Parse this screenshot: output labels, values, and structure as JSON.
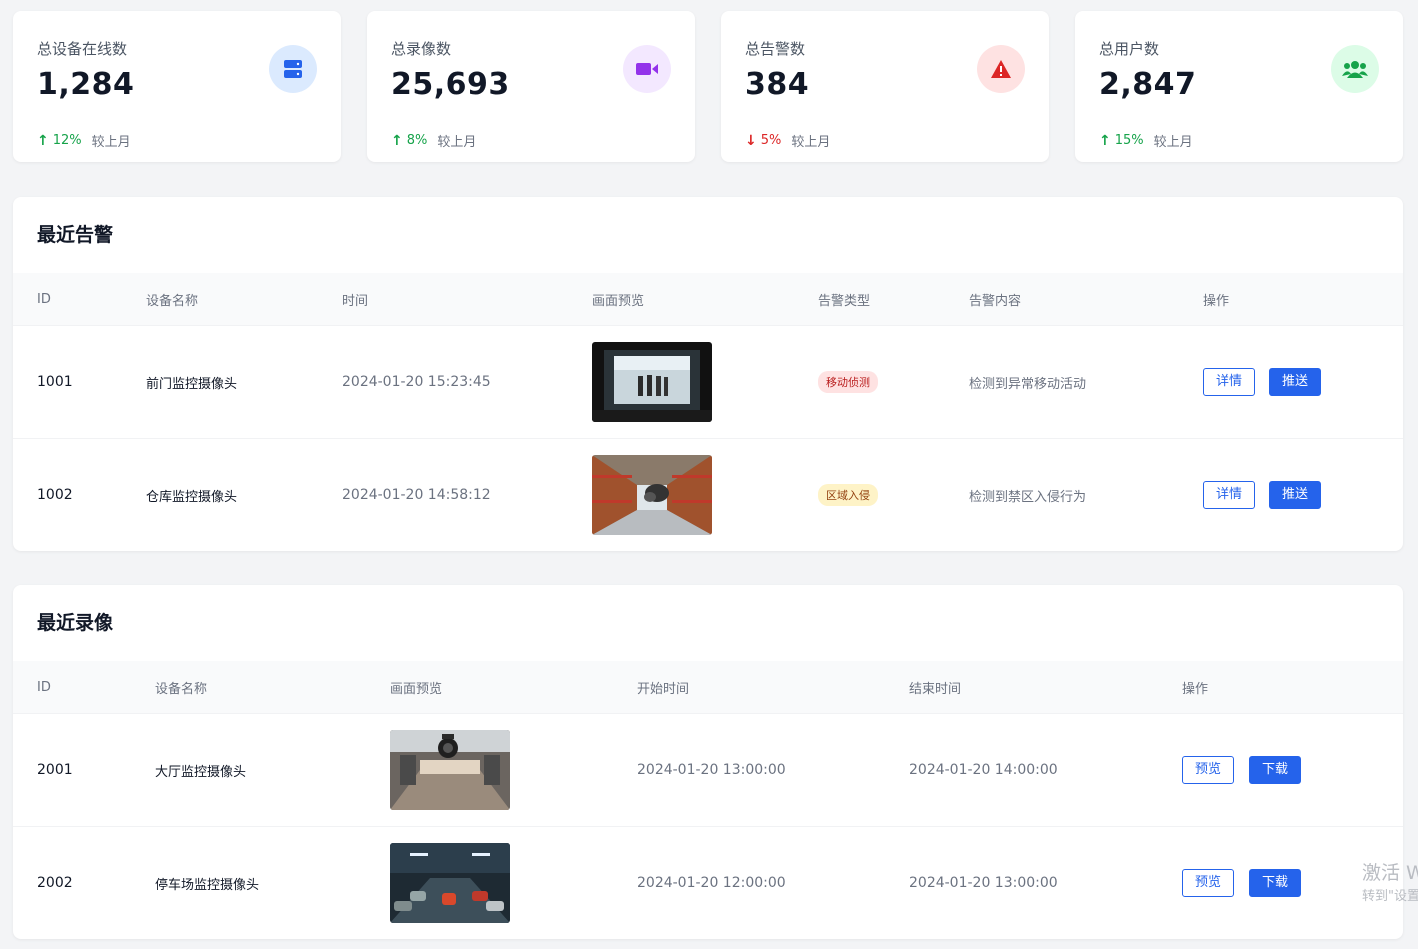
{
  "stats": [
    {
      "label": "总设备在线数",
      "value": "1,284",
      "trend": "12%",
      "direction": "up",
      "note": "较上月",
      "icon": "server-icon",
      "icon_color": "#2563eb",
      "icon_bg": "#dbeafe"
    },
    {
      "label": "总录像数",
      "value": "25,693",
      "trend": "8%",
      "direction": "up",
      "note": "较上月",
      "icon": "video-camera-icon",
      "icon_color": "#9333ea",
      "icon_bg": "#f3e8ff"
    },
    {
      "label": "总告警数",
      "value": "384",
      "trend": "5%",
      "direction": "down",
      "note": "较上月",
      "icon": "warning-icon",
      "icon_color": "#dc2626",
      "icon_bg": "#fee2e2"
    },
    {
      "label": "总用户数",
      "value": "2,847",
      "trend": "15%",
      "direction": "up",
      "note": "较上月",
      "icon": "users-icon",
      "icon_color": "#16a34a",
      "icon_bg": "#dcfce7"
    }
  ],
  "alerts": {
    "title": "最近告警",
    "columns": [
      "ID",
      "设备名称",
      "时间",
      "画面预览",
      "告警类型",
      "告警内容",
      "操作"
    ],
    "rows": [
      {
        "id": "1001",
        "device": "前门监控摄像头",
        "time": "2024-01-20 15:23:45",
        "type": "移动侦测",
        "type_color": "red",
        "content": "检测到异常移动活动",
        "action1": "详情",
        "action2": "推送"
      },
      {
        "id": "1002",
        "device": "仓库监控摄像头",
        "time": "2024-01-20 14:58:12",
        "type": "区域入侵",
        "type_color": "yellow",
        "content": "检测到禁区入侵行为",
        "action1": "详情",
        "action2": "推送"
      }
    ]
  },
  "recordings": {
    "title": "最近录像",
    "columns": [
      "ID",
      "设备名称",
      "画面预览",
      "开始时间",
      "结束时间",
      "操作"
    ],
    "rows": [
      {
        "id": "2001",
        "device": "大厅监控摄像头",
        "start": "2024-01-20 13:00:00",
        "end": "2024-01-20 14:00:00",
        "action1": "预览",
        "action2": "下载"
      },
      {
        "id": "2002",
        "device": "停车场监控摄像头",
        "start": "2024-01-20 12:00:00",
        "end": "2024-01-20 13:00:00",
        "action1": "预览",
        "action2": "下载"
      }
    ]
  },
  "watermark": {
    "line1": "激活 W",
    "line2": "转到\"设置"
  }
}
